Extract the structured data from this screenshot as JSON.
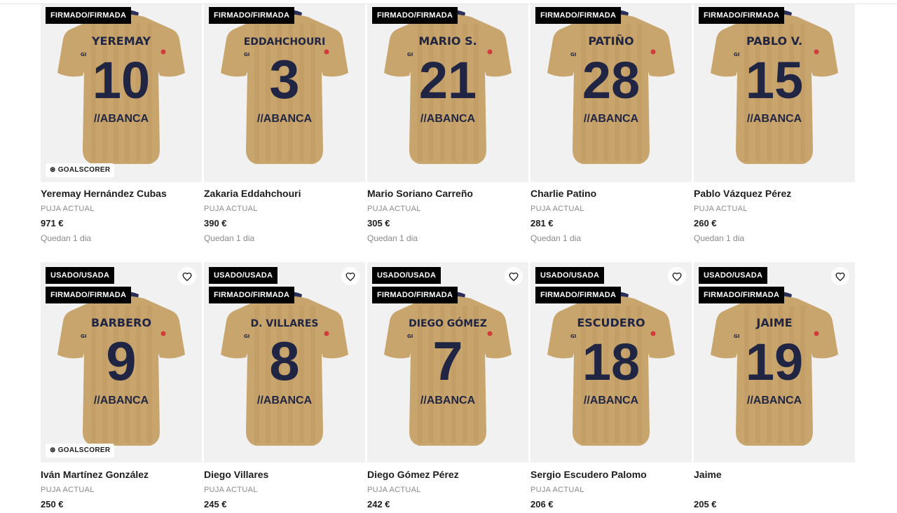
{
  "colors": {
    "jersey": "#c9a56e",
    "jersey_stripe": "#b9935c",
    "print": "#1f2542",
    "collar": "#2a2f5a",
    "badge_bg": "#000000",
    "card_bg": "#f1f1f1"
  },
  "row1": [
    {
      "badges": [
        "FIRMADO/FIRMADA"
      ],
      "jersey_name": "YEREMAY",
      "number": "10",
      "sponsor": "//ABANCA",
      "goalscorer": "GOALSCORER",
      "title": "Yeremay Hernández Cubas",
      "bid_label": "PUJA ACTUAL",
      "price": "971 €",
      "remaining": "Quedan 1 dia"
    },
    {
      "badges": [
        "FIRMADO/FIRMADA"
      ],
      "jersey_name": "EDDAHCHOURI",
      "number": "3",
      "sponsor": "//ABANCA",
      "goalscorer": "",
      "title": "Zakaria Eddahchouri",
      "bid_label": "PUJA ACTUAL",
      "price": "390 €",
      "remaining": "Quedan 1 dia"
    },
    {
      "badges": [
        "FIRMADO/FIRMADA"
      ],
      "jersey_name": "MARIO S.",
      "number": "21",
      "sponsor": "//ABANCA",
      "goalscorer": "",
      "title": "Mario Soriano Carreño",
      "bid_label": "PUJA ACTUAL",
      "price": "305 €",
      "remaining": "Quedan 1 dia"
    },
    {
      "badges": [
        "FIRMADO/FIRMADA"
      ],
      "jersey_name": "PATIÑO",
      "number": "28",
      "sponsor": "//ABANCA",
      "goalscorer": "",
      "title": "Charlie Patino",
      "bid_label": "PUJA ACTUAL",
      "price": "281 €",
      "remaining": "Quedan 1 dia"
    },
    {
      "badges": [
        "FIRMADO/FIRMADA"
      ],
      "jersey_name": "PABLO V.",
      "number": "15",
      "sponsor": "//ABANCA",
      "goalscorer": "",
      "title": "Pablo Vázquez Pérez",
      "bid_label": "PUJA ACTUAL",
      "price": "260 €",
      "remaining": "Quedan 1 dia"
    }
  ],
  "row2": [
    {
      "badges": [
        "USADO/USADA",
        "FIRMADO/FIRMADA"
      ],
      "jersey_name": "BARBERO",
      "number": "9",
      "sponsor": "//ABANCA",
      "goalscorer": "GOALSCORER",
      "title": "Iván Martínez González",
      "bid_label": "PUJA ACTUAL",
      "price": "250 €",
      "remaining": ""
    },
    {
      "badges": [
        "USADO/USADA",
        "FIRMADO/FIRMADA"
      ],
      "jersey_name": "D. VILLARES",
      "number": "8",
      "sponsor": "//ABANCA",
      "goalscorer": "",
      "title": "Diego Villares",
      "bid_label": "PUJA ACTUAL",
      "price": "245 €",
      "remaining": ""
    },
    {
      "badges": [
        "USADO/USADA",
        "FIRMADO/FIRMADA"
      ],
      "jersey_name": "DIEGO GÓMEZ",
      "number": "7",
      "sponsor": "//ABANCA",
      "goalscorer": "",
      "title": "Diego Gómez Pérez",
      "bid_label": "PUJA ACTUAL",
      "price": "242 €",
      "remaining": ""
    },
    {
      "badges": [
        "USADO/USADA",
        "FIRMADO/FIRMADA"
      ],
      "jersey_name": "ESCUDERO",
      "number": "18",
      "sponsor": "//ABANCA",
      "goalscorer": "",
      "title": "Sergio Escudero Palomo",
      "bid_label": "PUJA ACTUAL",
      "price": "206 €",
      "remaining": ""
    },
    {
      "badges": [
        "USADO/USADA",
        "FIRMADO/FIRMADA"
      ],
      "jersey_name": "JAIME",
      "number": "19",
      "sponsor": "//ABANCA",
      "goalscorer": "",
      "title": "Jaime",
      "bid_label": "",
      "price": "205 €",
      "remaining": ""
    }
  ],
  "icons": {
    "favorite": "heart-outline-icon",
    "goalscorer": "football-icon"
  }
}
